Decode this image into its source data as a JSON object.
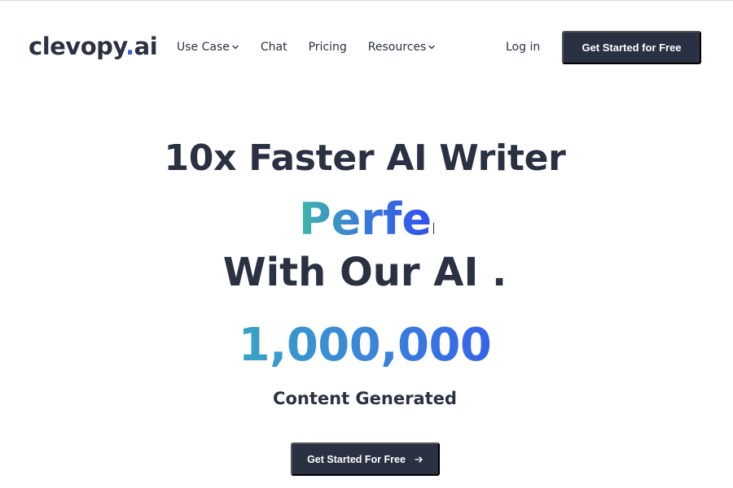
{
  "header": {
    "logo_main": "clevopy",
    "logo_dot": ".",
    "logo_tld": "ai",
    "nav": [
      {
        "label": "Use Case",
        "icon": "chevron-down-icon"
      },
      {
        "label": "Chat"
      },
      {
        "label": "Pricing"
      },
      {
        "label": "Resources",
        "icon": "chevron-down-icon"
      }
    ],
    "login_label": "Log in",
    "cta_label": "Get Started for Free"
  },
  "hero": {
    "title": "10x Faster AI Writer",
    "typing_text": "Perfe",
    "subtitle": "With Our AI ."
  },
  "stats": {
    "counter": "1,000,000",
    "counter_label": "Content Generated"
  },
  "cta_bottom": {
    "label": "Get Started For Free",
    "icon": "arrow-right-icon"
  },
  "colors": {
    "primary_dark": "#2a3142",
    "accent_blue": "#3b5bdb",
    "gradient_start": "#3fb6a8",
    "gradient_end": "#2f4ff0"
  }
}
